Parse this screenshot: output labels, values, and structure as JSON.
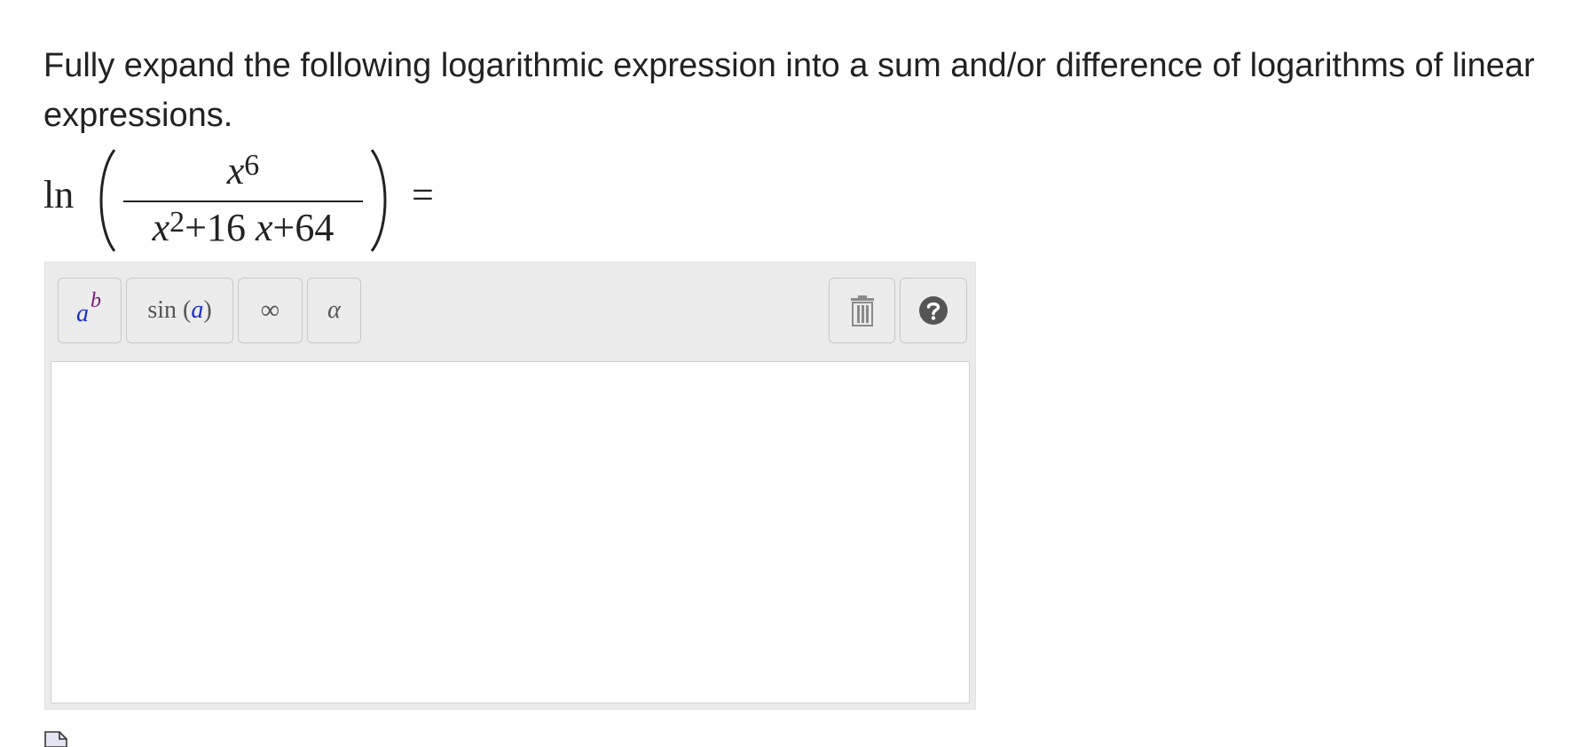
{
  "question": {
    "prompt": "Fully expand the following logarithmic expression into a sum and/or difference of logarithms of linear expressions."
  },
  "expression": {
    "function": "ln",
    "numerator_base": "x",
    "numerator_exponent": "6",
    "denominator": {
      "term1_base": "x",
      "term1_exponent": "2",
      "op1": "+",
      "term2_coef": "16",
      "term2_var": "x",
      "op2": "+",
      "term3": "64"
    },
    "equals": "="
  },
  "toolbar": {
    "power": {
      "base": "a",
      "exponent": "b",
      "icon": "superscript-icon"
    },
    "function": {
      "name": "sin",
      "open": "(",
      "arg": "a",
      "close": ")"
    },
    "infinity": "∞",
    "greek": "α",
    "trash_icon": "trash-icon",
    "help_icon": "help-icon"
  },
  "answer": {
    "value": ""
  },
  "colors": {
    "text": "#222222",
    "toolbar_bg": "#ebebeb",
    "variable_blue": "#1a2fd1",
    "exponent_purple": "#7a1a7a",
    "help_circle": "#555555"
  }
}
